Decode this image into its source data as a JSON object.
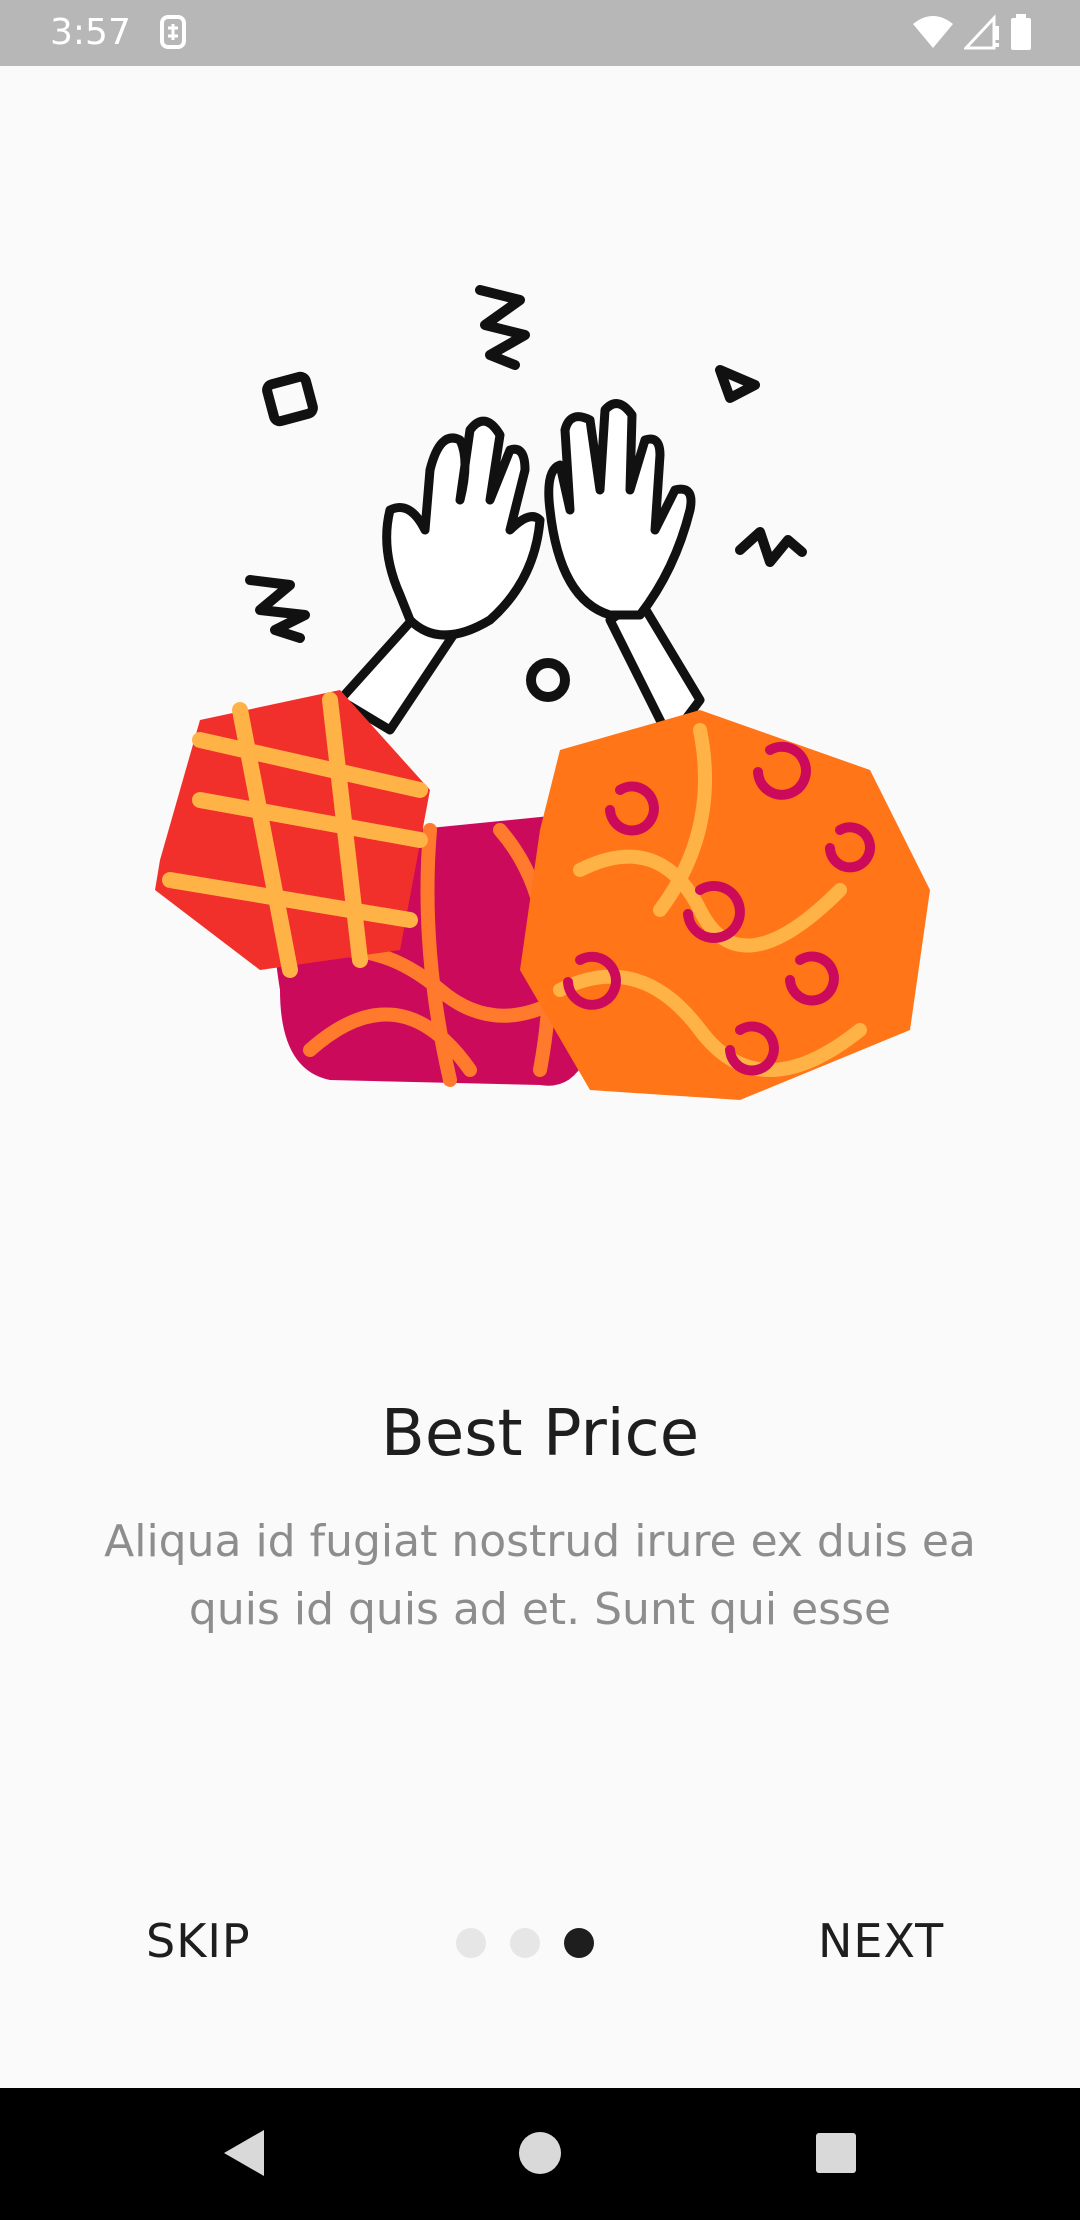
{
  "status_bar": {
    "time": "3:57",
    "icons": [
      "sim-notification-icon",
      "wifi-icon",
      "cell-signal-icon",
      "battery-icon"
    ]
  },
  "onboarding": {
    "title": "Best Price",
    "description": "Aliqua id fugiat nostrud irure ex duis ea quis id quis ad et. Sunt qui esse",
    "illustration": "high-five-hands-with-gifts-illustration",
    "page_indicator": {
      "pages": 3,
      "current": 3
    },
    "skip_label": "SKIP",
    "next_label": "NEXT"
  },
  "nav_bar": {
    "buttons": [
      "back-icon",
      "home-icon",
      "recents-icon"
    ]
  },
  "colors": {
    "background": "#fafafa",
    "text_primary": "#1e1e1e",
    "text_secondary": "#8d8d8d",
    "gift_red": "#f2302b",
    "gift_magenta": "#cc0a5b",
    "gift_orange": "#ff7517",
    "ribbon": "#ffb347"
  }
}
